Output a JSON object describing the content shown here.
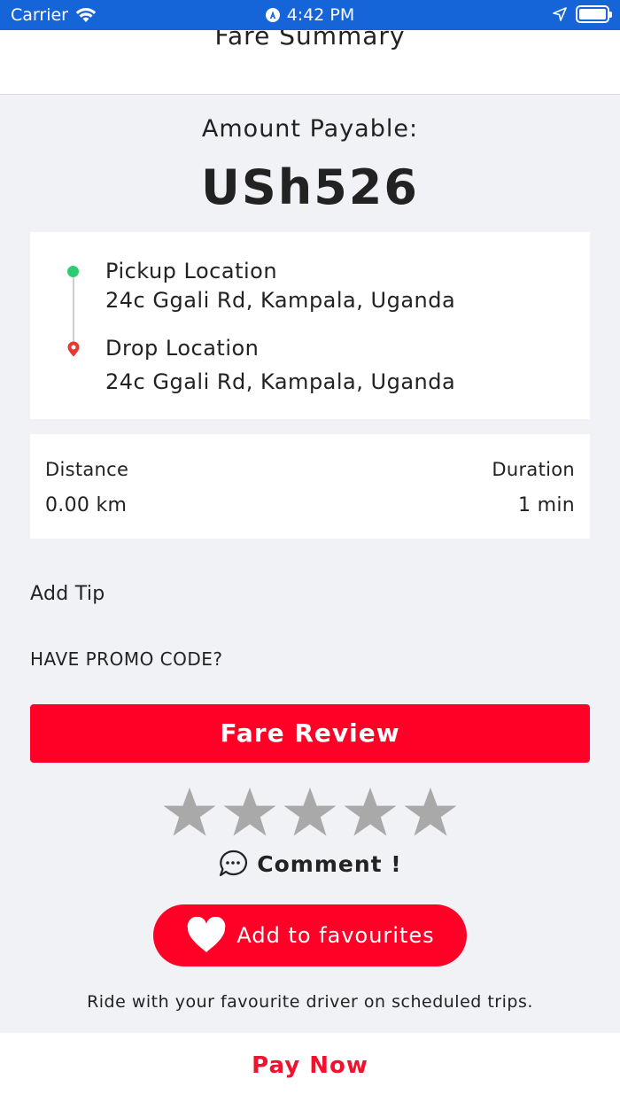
{
  "status_bar": {
    "carrier": "Carrier",
    "time": "4:42 PM",
    "icons": [
      "wifi-icon",
      "accessibility-icon",
      "location-arrow-icon",
      "battery-icon"
    ]
  },
  "header": {
    "title": "Fare Summary"
  },
  "amount": {
    "label": "Amount Payable:",
    "value": "USh526"
  },
  "trip": {
    "pickup_title": "Pickup Location",
    "pickup_address": "24c Ggali Rd, Kampala, Uganda",
    "drop_title": "Drop Location",
    "drop_address": "24c Ggali Rd, Kampala, Uganda",
    "pickup_color": "#2ecc71",
    "drop_color": "#e53935"
  },
  "stats": {
    "distance_label": "Distance",
    "distance_value": "0.00 km",
    "duration_label": "Duration",
    "duration_value": "1 min"
  },
  "add_tip": "Add Tip",
  "promo": "HAVE PROMO CODE?",
  "fare_review_label": "Fare Review",
  "rating": {
    "value": 0,
    "max": 5,
    "star_color": "#a9a9a9"
  },
  "comment_label": "Comment !",
  "favourites": {
    "button_label": "Add to favourites",
    "note": "Ride with your favourite driver on scheduled trips."
  },
  "pay_now_label": "Pay Now",
  "colors": {
    "accent": "#ff0027",
    "status_bar": "#1565d8",
    "background": "#f1f2f6"
  }
}
